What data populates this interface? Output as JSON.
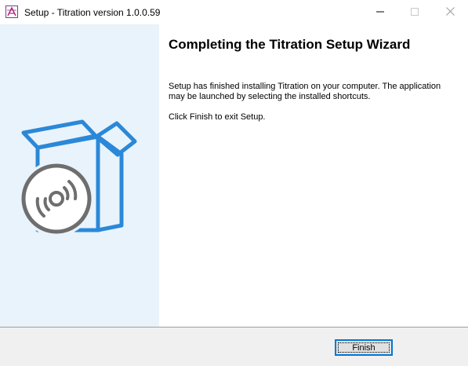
{
  "window": {
    "title": "Setup - Titration version 1.0.0.59"
  },
  "titlebar_buttons": {
    "minimize_icon": "minimize-icon",
    "maximize_icon": "maximize-icon",
    "close_icon": "close-icon"
  },
  "banner": {
    "icon": "software-box-with-disc-icon",
    "accent_color": "#2b88d8",
    "disc_color": "#6e6e6e",
    "background_color": "#e9f3fb"
  },
  "content": {
    "heading": "Completing the Titration Setup Wizard",
    "paragraph1": "Setup has finished installing Titration on your computer. The application may be launched by selecting the installed shortcuts.",
    "paragraph2": "Click Finish to exit Setup."
  },
  "footer": {
    "finish_label": "Finish"
  }
}
